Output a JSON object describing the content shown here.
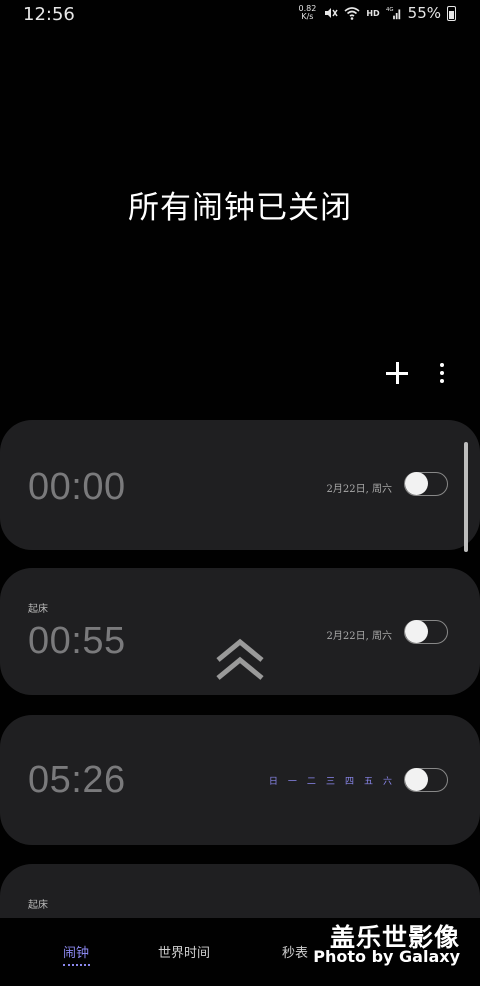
{
  "status_bar": {
    "time": "12:56",
    "net_speed_value": "0.82",
    "net_speed_unit": "K/s",
    "hd_label": "HD",
    "signal_label": "4G",
    "battery": "55%"
  },
  "headline": "所有闹钟已关闭",
  "alarms": [
    {
      "label": "",
      "time": "00:00",
      "date": "2月22日, 周六",
      "days": [],
      "enabled": false
    },
    {
      "label": "起床",
      "time": "00:55",
      "date": "2月22日, 周六",
      "days": [],
      "enabled": false
    },
    {
      "label": "",
      "time": "05:26",
      "date": "",
      "days": [
        "日",
        "一",
        "二",
        "三",
        "四",
        "五",
        "六"
      ],
      "enabled": false
    },
    {
      "label": "起床",
      "time": "",
      "date": "",
      "days": [],
      "enabled": false
    }
  ],
  "tabs": [
    {
      "label": "闹钟",
      "active": true
    },
    {
      "label": "世界时间",
      "active": false
    },
    {
      "label": "秒表",
      "active": false
    }
  ],
  "watermark": {
    "chinese": "盖乐世影像",
    "english": "Photo by Galaxy"
  }
}
